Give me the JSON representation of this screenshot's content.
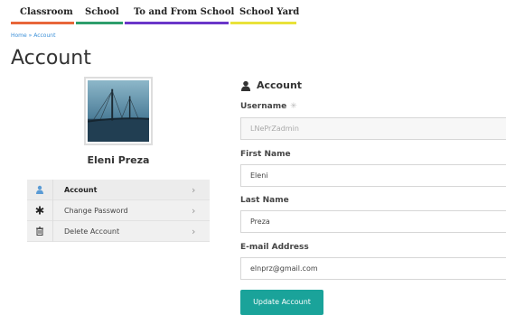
{
  "nav": {
    "tabs": [
      {
        "label": "Classroom",
        "color": "#e8663a"
      },
      {
        "label": "School",
        "color": "#2e9e6c"
      },
      {
        "label": "To and From School",
        "color": "#6a36c9"
      },
      {
        "label": "School Yard",
        "color": "#e9e23a"
      }
    ]
  },
  "breadcrumb": "Home » Account",
  "page_title": "Account",
  "profile": {
    "name": "Eleni Preza",
    "avatar_icon": "bridge-photo"
  },
  "side_menu": {
    "items": [
      {
        "label": "Account",
        "icon": "user-icon",
        "active": true
      },
      {
        "label": "Change Password",
        "icon": "asterisk-icon",
        "active": false
      },
      {
        "label": "Delete Account",
        "icon": "trash-icon",
        "active": false
      }
    ],
    "chevron": "›"
  },
  "form": {
    "heading": "Account",
    "username_label": "Username",
    "required_mark": "✳",
    "username_value": "LNePrZadmin",
    "first_name_label": "First Name",
    "first_name_value": "Eleni",
    "last_name_label": "Last Name",
    "last_name_value": "Preza",
    "email_label": "E-mail Address",
    "email_value": "elnprz@gmail.com",
    "submit_label": "Update Account"
  },
  "colors": {
    "accent": "#1aa39a",
    "link": "#3a8fd8"
  }
}
